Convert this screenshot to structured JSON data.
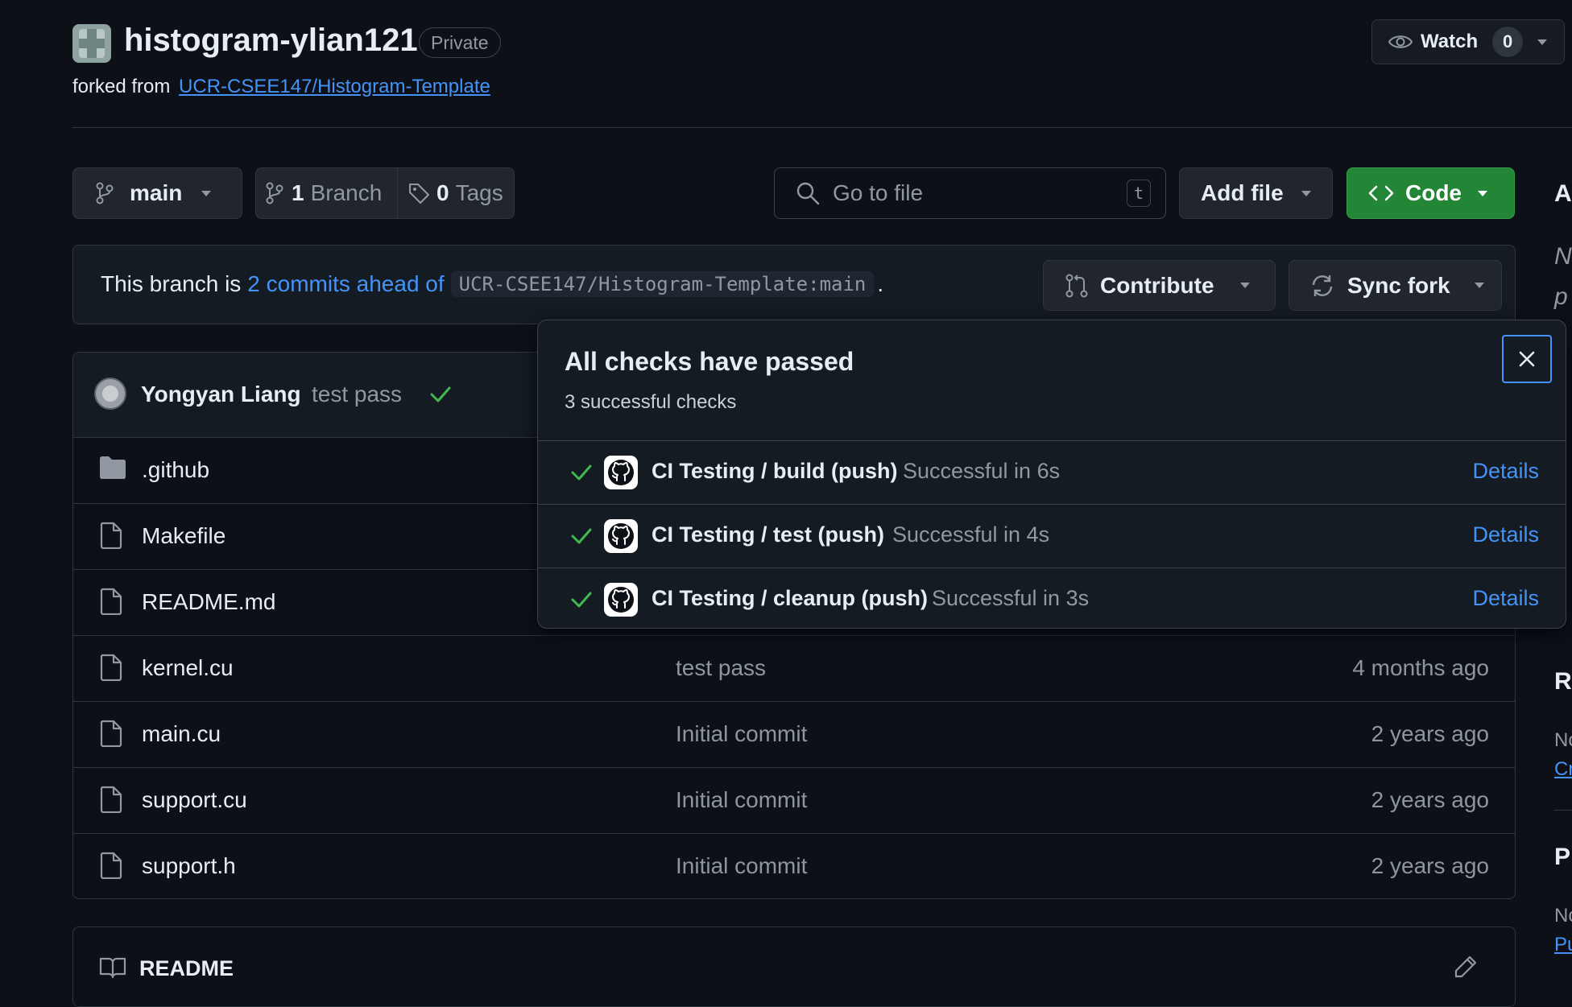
{
  "repo": {
    "name": "histogram-ylian121",
    "visibility": "Private",
    "forked_from_label": "forked from",
    "forked_from_link": "UCR-CSEE147/Histogram-Template"
  },
  "watch": {
    "label": "Watch",
    "count": "0"
  },
  "toolbar": {
    "branch": "main",
    "branches_count": "1",
    "branches_label": "Branch",
    "tags_count": "0",
    "tags_label": "Tags",
    "search_placeholder": "Go to file",
    "search_shortcut": "t",
    "add_file_label": "Add file",
    "code_label": "Code"
  },
  "branch_status": {
    "prefix": "This branch is",
    "link": "2 commits ahead of",
    "ref": "UCR-CSEE147/Histogram-Template:main",
    "suffix": ".",
    "contribute_label": "Contribute",
    "sync_label": "Sync fork"
  },
  "latest_commit": {
    "author": "Yongyan Liang",
    "message": "test pass"
  },
  "files": [
    {
      "name": ".github",
      "type": "folder",
      "message": "",
      "date": ""
    },
    {
      "name": "Makefile",
      "type": "file",
      "message": "",
      "date": ""
    },
    {
      "name": "README.md",
      "type": "file",
      "message": "",
      "date": ""
    },
    {
      "name": "kernel.cu",
      "type": "file",
      "message": "test pass",
      "date": "4 months ago"
    },
    {
      "name": "main.cu",
      "type": "file",
      "message": "Initial commit",
      "date": "2 years ago"
    },
    {
      "name": "support.cu",
      "type": "file",
      "message": "Initial commit",
      "date": "2 years ago"
    },
    {
      "name": "support.h",
      "type": "file",
      "message": "Initial commit",
      "date": "2 years ago"
    }
  ],
  "readme": {
    "label": "README"
  },
  "checks": {
    "title": "All checks have passed",
    "subtitle": "3 successful checks",
    "items": [
      {
        "name": "CI Testing / build (push)",
        "status": "Successful in 6s",
        "details": "Details"
      },
      {
        "name": "CI Testing / test (push)",
        "status": "Successful in 4s",
        "details": "Details"
      },
      {
        "name": "CI Testing / cleanup (push)",
        "status": "Successful in 3s",
        "details": "Details"
      }
    ]
  },
  "sidebar_partial": [
    "A",
    "N",
    "p",
    "R",
    "Nc",
    "Cr",
    "P",
    "Nc",
    "Pu"
  ],
  "colors": {
    "background": "#0d1117",
    "link": "#4493f8",
    "success": "#3fb950",
    "code_button": "#238636",
    "border": "#30363d"
  }
}
